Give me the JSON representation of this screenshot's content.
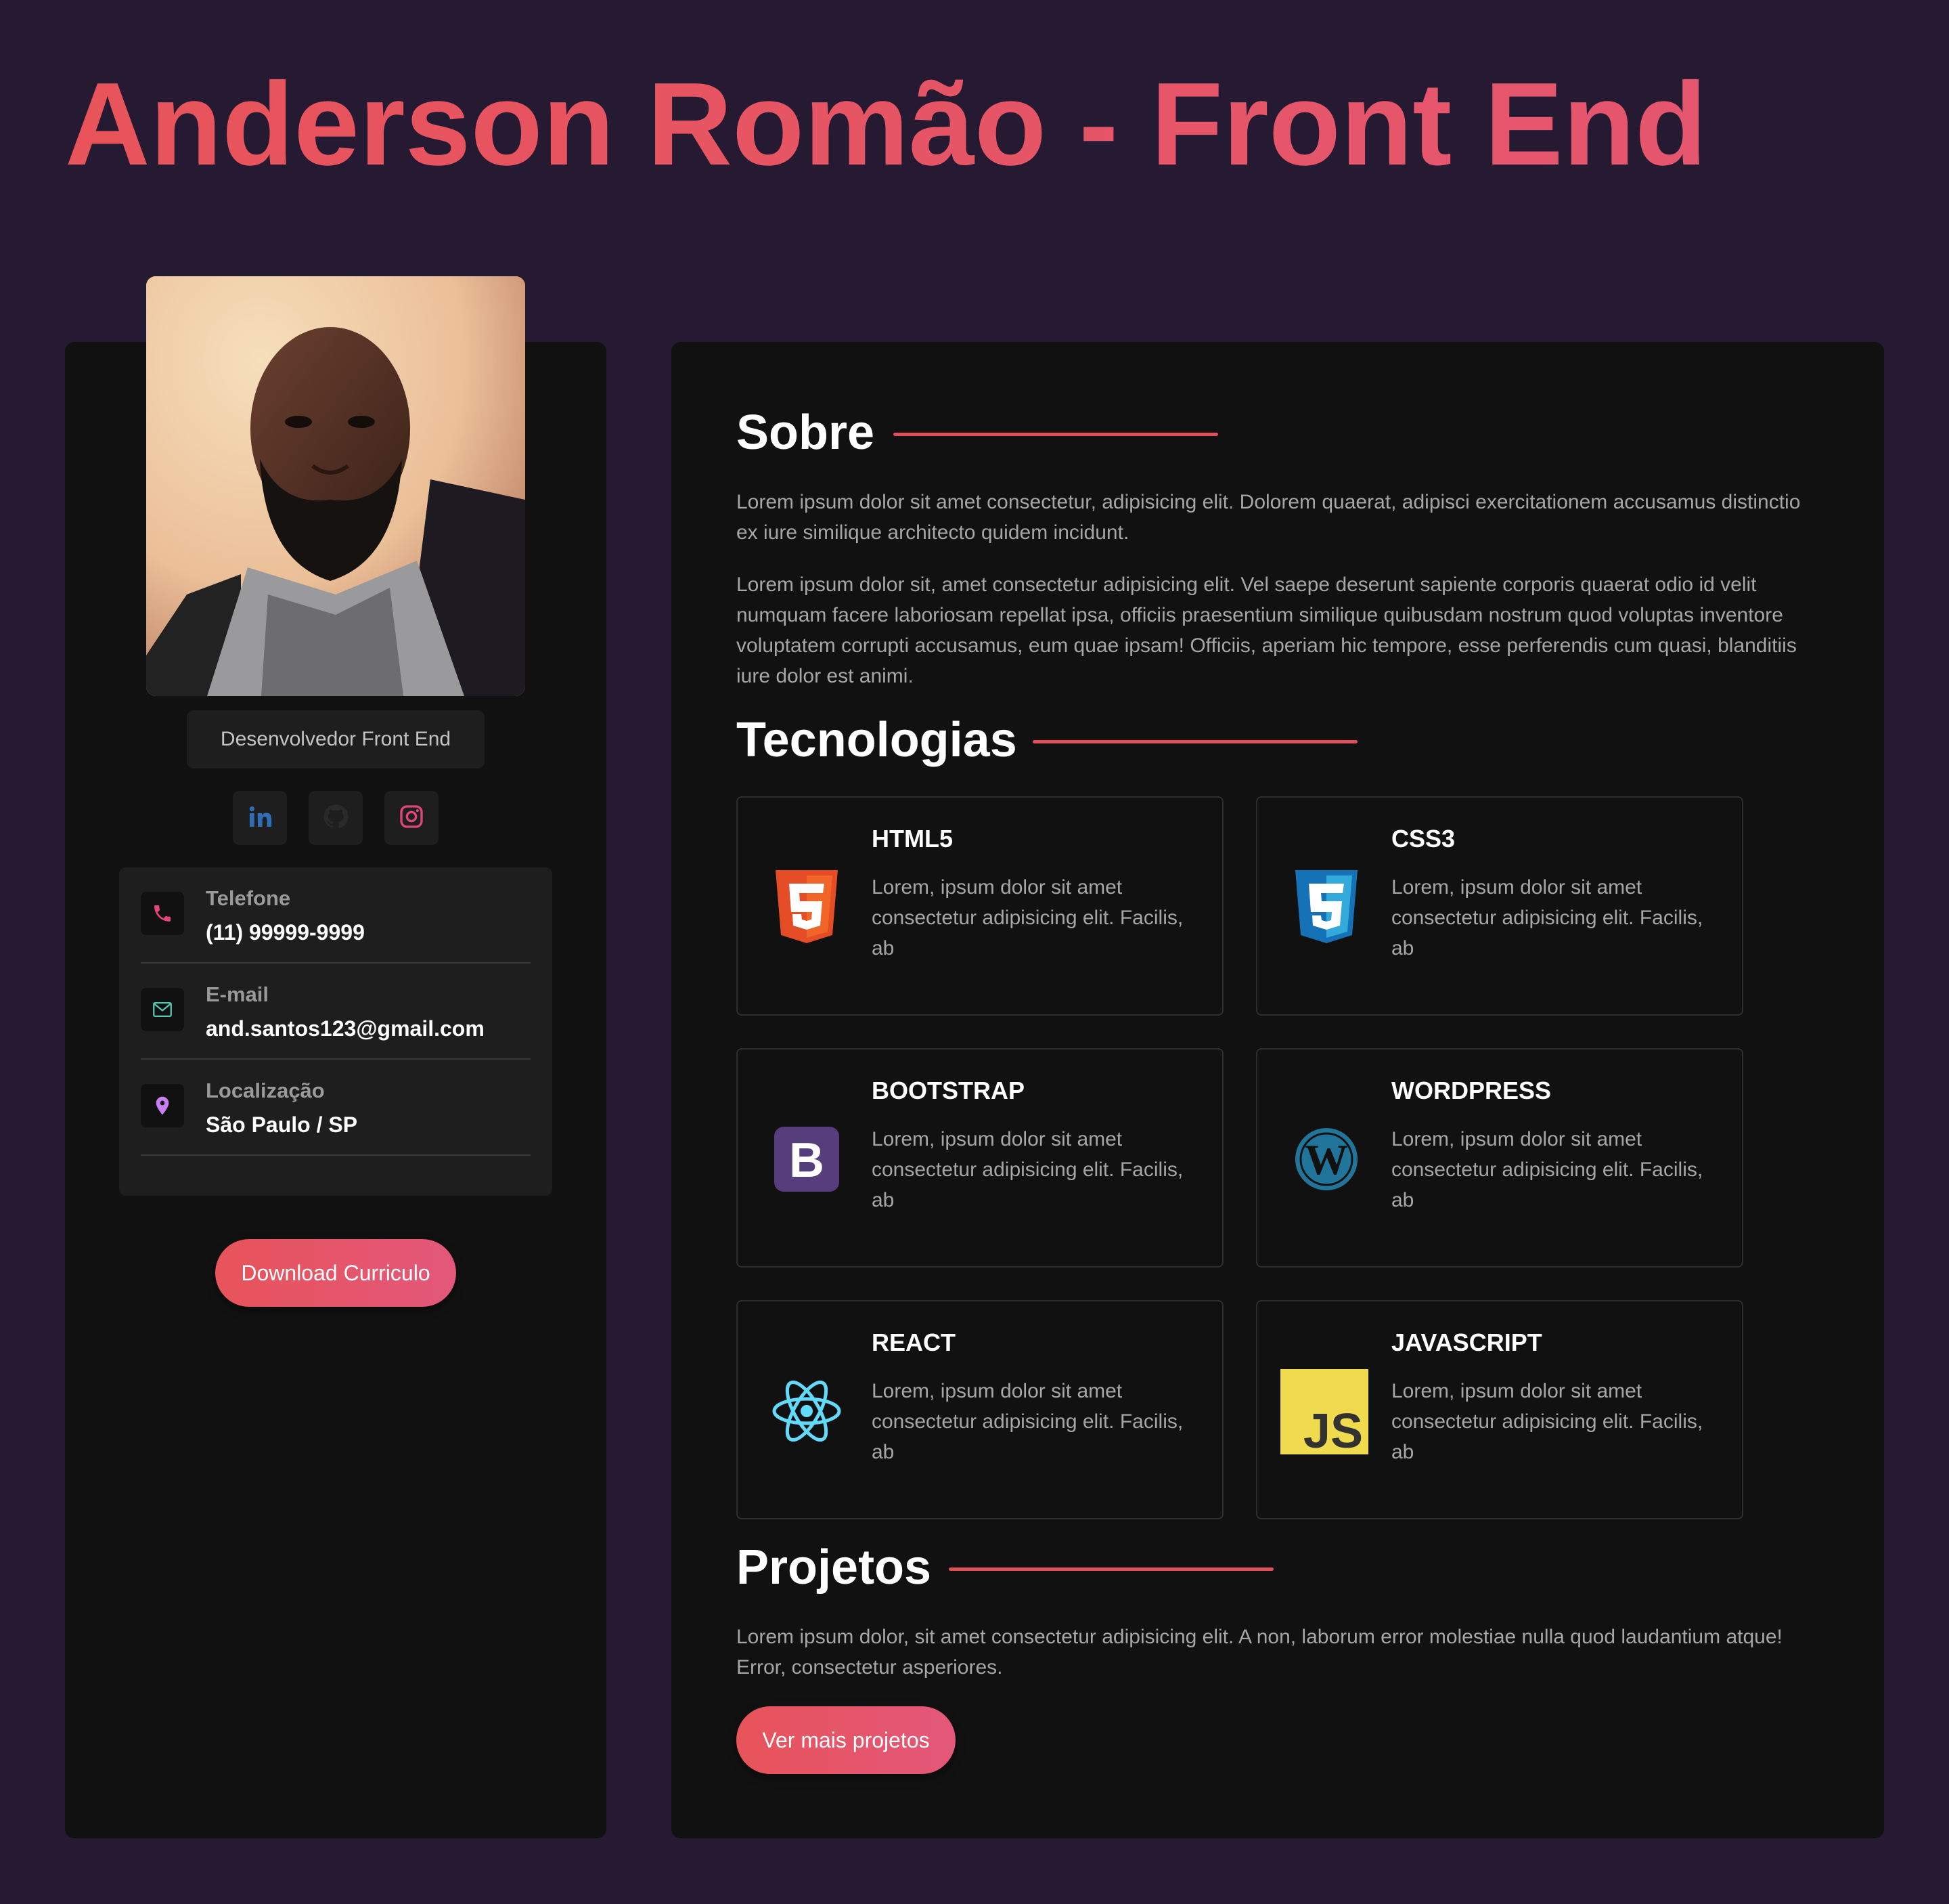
{
  "header": {
    "title": "Anderson Romão - Front End"
  },
  "sidebar": {
    "photo_alt": "Anderson Romão",
    "role": "Desenvolvedor Front End",
    "socials": [
      {
        "name": "linkedin-icon",
        "color": "#2f6db5"
      },
      {
        "name": "github-icon",
        "color": "#2a2a2a"
      },
      {
        "name": "instagram-icon",
        "color": "#e3447a"
      }
    ],
    "contacts": [
      {
        "label": "Telefone",
        "value": "(11) 99999-9999",
        "icon": "phone-icon",
        "color": "#e3447a"
      },
      {
        "label": "E-mail",
        "value": "and.santos123@gmail.com",
        "icon": "mail-icon",
        "color": "#55c7b8"
      },
      {
        "label": "Localização",
        "value": "São Paulo / SP",
        "icon": "location-pin-icon",
        "color": "#c97ef2"
      }
    ],
    "download_label": "Download Curriculo"
  },
  "main": {
    "about": {
      "title": "Sobre",
      "paragraphs": [
        "Lorem ipsum dolor sit amet consectetur, adipisicing elit. Dolorem quaerat, adipisci exercitationem accusamus distinctio ex iure similique architecto quidem incidunt.",
        "Lorem ipsum dolor sit, amet consectetur adipisicing elit. Vel saepe deserunt sapiente corporis quaerat odio id velit numquam facere laboriosam repellat ipsa, officiis praesentium similique quibusdam nostrum quod voluptas inventore voluptatem corrupti accusamus, eum quae ipsam! Officiis, aperiam hic tempore, esse perferendis cum quasi, blanditiis iure dolor est animi."
      ]
    },
    "tech": {
      "title": "Tecnologias",
      "items": [
        {
          "name": "HTML5",
          "desc": "Lorem, ipsum dolor sit amet consectetur adipisicing elit. Facilis, ab",
          "icon": "html5-icon",
          "color": "#e44d26"
        },
        {
          "name": "CSS3",
          "desc": "Lorem, ipsum dolor sit amet consectetur adipisicing elit. Facilis, ab",
          "icon": "css3-icon",
          "color": "#2965f1"
        },
        {
          "name": "BOOTSTRAP",
          "desc": "Lorem, ipsum dolor sit amet consectetur adipisicing elit. Facilis, ab",
          "icon": "bootstrap-icon",
          "color": "#563d7c"
        },
        {
          "name": "WORDPRESS",
          "desc": "Lorem, ipsum dolor sit amet consectetur adipisicing elit. Facilis, ab",
          "icon": "wordpress-icon",
          "color": "#21759b"
        },
        {
          "name": "REACT",
          "desc": "Lorem, ipsum dolor sit amet consectetur adipisicing elit. Facilis, ab",
          "icon": "react-icon",
          "color": "#61dafb"
        },
        {
          "name": "JAVASCRIPT",
          "desc": "Lorem, ipsum dolor sit amet consectetur adipisicing elit. Facilis, ab",
          "icon": "javascript-icon",
          "color": "#f0db4f"
        }
      ]
    },
    "projects": {
      "title": "Projetos",
      "text": "Lorem ipsum dolor, sit amet consectetur adipisicing elit. A non, laborum error molestiae nulla quod laudantium atque! Error, consectetur asperiores.",
      "button_label": "Ver mais projetos"
    }
  },
  "colors": {
    "background": "#261a33",
    "card": "#111111",
    "accent": "#e8545a"
  }
}
